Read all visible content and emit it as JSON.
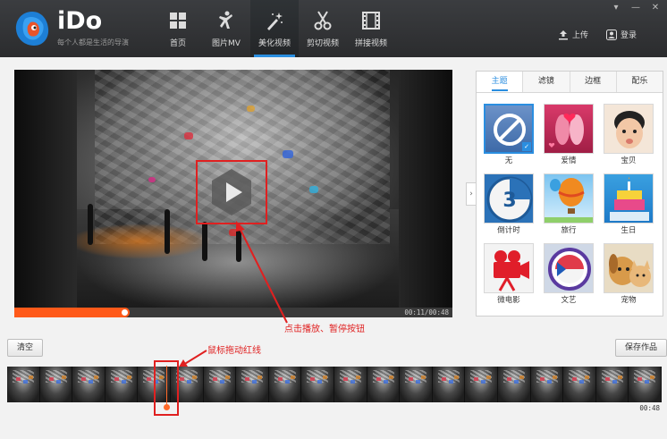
{
  "app": {
    "name": "iDo",
    "slogan": "每个人都是生活的导演"
  },
  "nav": {
    "items": [
      {
        "label": "首页",
        "icon": "grid-icon"
      },
      {
        "label": "图片MV",
        "icon": "dancer-icon"
      },
      {
        "label": "美化视频",
        "icon": "magic-wand-icon",
        "active": true
      },
      {
        "label": "剪切视频",
        "icon": "scissors-icon"
      },
      {
        "label": "拼接视频",
        "icon": "film-strip-icon"
      }
    ]
  },
  "header": {
    "upload_label": "上传",
    "login_label": "登录"
  },
  "window_controls": {
    "menu": "▾",
    "minimize": "—",
    "close": "✕"
  },
  "player": {
    "time": "00:11/00:48",
    "progress": 0.25
  },
  "panel": {
    "tabs": [
      "主题",
      "滤镜",
      "边框",
      "配乐"
    ],
    "active_tab": 0,
    "collapse_glyph": "›",
    "themes": [
      {
        "label": "无",
        "icon": "none-icon",
        "selected": true
      },
      {
        "label": "爱情",
        "icon": "love-icon"
      },
      {
        "label": "宝贝",
        "icon": "baby-icon"
      },
      {
        "label": "倒计时",
        "icon": "countdown-icon"
      },
      {
        "label": "旅行",
        "icon": "balloon-icon"
      },
      {
        "label": "生日",
        "icon": "birthday-cake-icon"
      },
      {
        "label": "微电影",
        "icon": "movie-camera-icon"
      },
      {
        "label": "文艺",
        "icon": "art-icon"
      },
      {
        "label": "宠物",
        "icon": "pet-icon"
      }
    ]
  },
  "annotations": {
    "play_hint": "点击播放、暂停按钮",
    "drag_hint": "鼠标拖动红线"
  },
  "bottom": {
    "clear_label": "清空",
    "save_label": "保存作品",
    "timeline_time": "00:48",
    "frame_count": 20
  },
  "colors": {
    "accent": "#2a8ee0",
    "progress": "#ff5a1a",
    "annotation": "#e02020",
    "header_bg": "#2f3033"
  }
}
